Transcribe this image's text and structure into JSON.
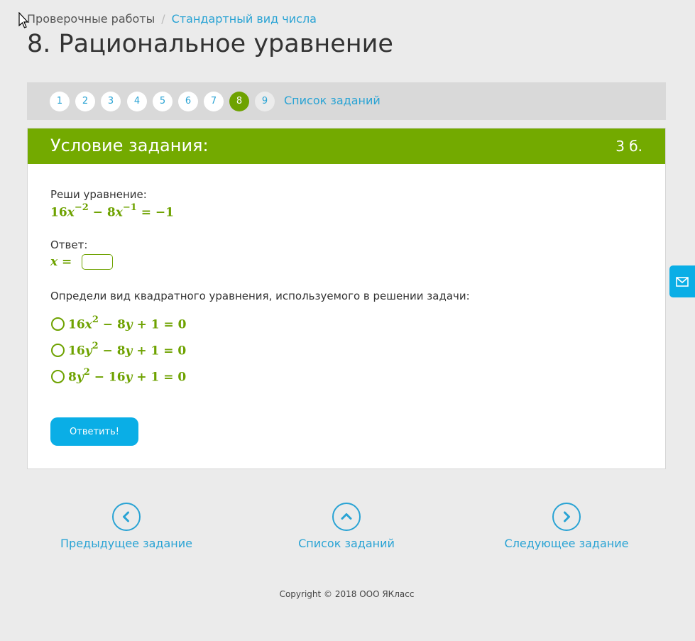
{
  "breadcrumb": {
    "crumb1": "Проверочные работы",
    "sep": "/",
    "crumb2": "Стандартный вид числа"
  },
  "page": {
    "title": "8. Рациональное уравнение"
  },
  "task_nav": {
    "numbers": [
      "1",
      "2",
      "3",
      "4",
      "5",
      "6",
      "7",
      "8",
      "9"
    ],
    "active": "8",
    "list_link": "Список заданий"
  },
  "card": {
    "title": "Условие задания:",
    "points": "3 б.",
    "prompt": "Реши уравнение:",
    "equation": "16x^-2 − 8x^-1 = −1",
    "answer_label": "Ответ:",
    "answer_prefix": "x =",
    "answer_value": "",
    "question2": "Определи вид квадратного уравнения, используемого в решении задачи:",
    "options": [
      "16x^2 − 8y + 1 = 0",
      "16y^2 − 8y + 1 = 0",
      "8y^2 − 16y + 1 = 0"
    ],
    "submit_label": "Ответить!"
  },
  "bottom_nav": {
    "prev": "Предыдущее задание",
    "list": "Список заданий",
    "next": "Следующее задание"
  },
  "footer": {
    "copyright": "Copyright © 2018 ООО ЯКласс"
  },
  "colors": {
    "green": "#73aa00",
    "blue": "#29a3d4",
    "button": "#0aaee6"
  },
  "icons": {
    "prev": "chevron-left-icon",
    "list": "chevron-up-icon",
    "next": "chevron-right-icon",
    "feedback": "envelope-icon",
    "cursor": "mouse-cursor-icon"
  }
}
